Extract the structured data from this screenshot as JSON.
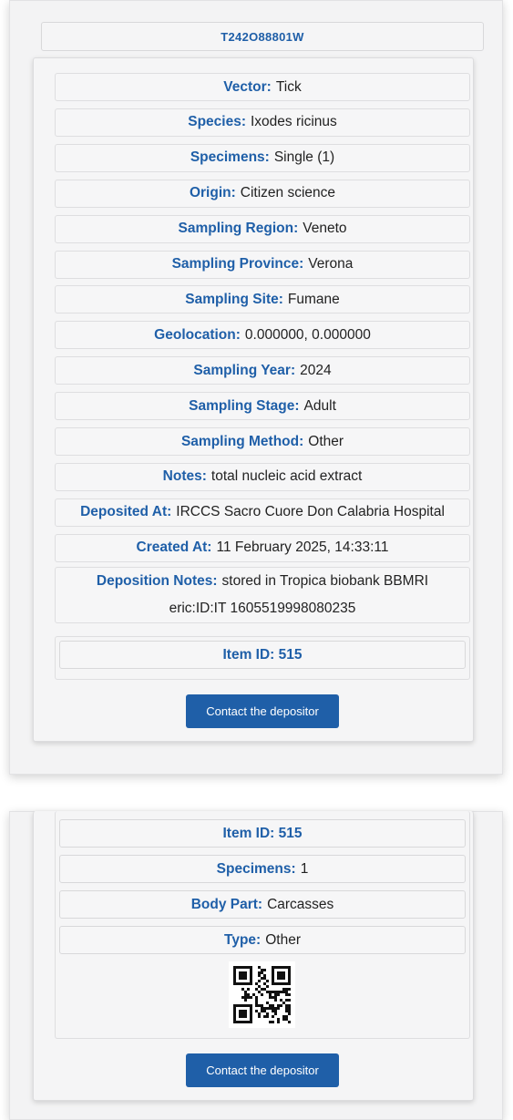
{
  "card1": {
    "code": "T242O88801W",
    "fields": [
      {
        "key": "Vector:",
        "value": "Tick"
      },
      {
        "key": "Species:",
        "value": "Ixodes ricinus"
      },
      {
        "key": "Specimens:",
        "value": "Single (1)"
      },
      {
        "key": "Origin:",
        "value": "Citizen science"
      },
      {
        "key": "Sampling Region:",
        "value": "Veneto"
      },
      {
        "key": "Sampling Province:",
        "value": "Verona"
      },
      {
        "key": "Sampling Site:",
        "value": "Fumane"
      },
      {
        "key": "Geolocation:",
        "value": "0.000000, 0.000000"
      },
      {
        "key": "Sampling Year:",
        "value": "2024"
      },
      {
        "key": "Sampling Stage:",
        "value": "Adult"
      },
      {
        "key": "Sampling Method:",
        "value": "Other"
      },
      {
        "key": "Notes:",
        "value": "total nucleic acid extract"
      },
      {
        "key": "Deposited At:",
        "value": "IRCCS Sacro Cuore Don Calabria Hospital"
      },
      {
        "key": "Created At:",
        "value": "11 February 2025, 14:33:11"
      }
    ],
    "deposition_notes": {
      "key": "Deposition Notes:",
      "line1": "stored in Tropica biobank BBMRI",
      "line2": "eric:ID:IT 1605519998080235"
    },
    "item_id": "Item ID: 515",
    "contact_label": "Contact the depositor"
  },
  "card2": {
    "item_id": "Item ID: 515",
    "fields": [
      {
        "key": "Specimens:",
        "value": "1"
      },
      {
        "key": "Body Part:",
        "value": "Carcasses"
      },
      {
        "key": "Type:",
        "value": "Other"
      }
    ],
    "qr_icon": "qr-code",
    "contact_label": "Contact the depositor"
  },
  "colors": {
    "accent": "#1f5fa8",
    "card_bg": "#f5f5f6",
    "border": "#dcdcde"
  }
}
